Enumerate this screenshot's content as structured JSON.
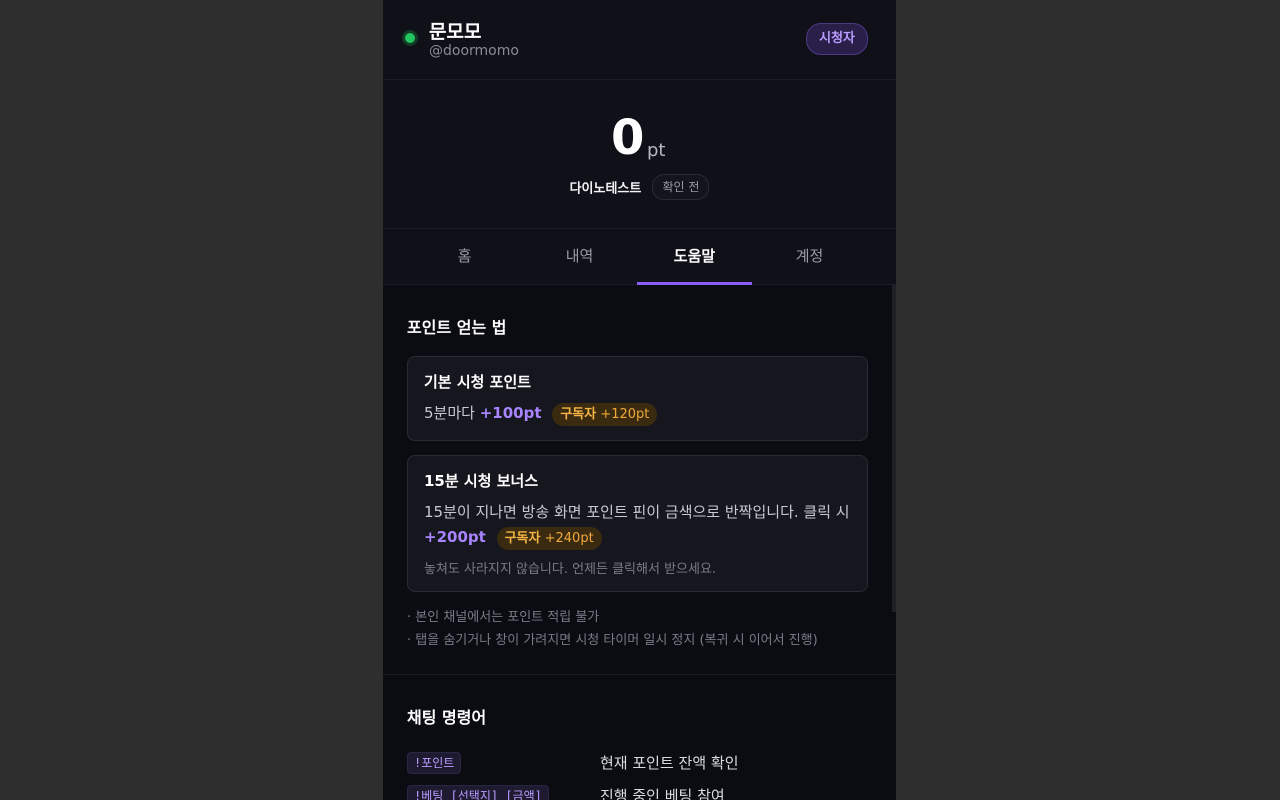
{
  "user": {
    "name": "문모모",
    "handle": "@doormomo",
    "role": "시청자"
  },
  "points": {
    "value": "0",
    "unit": "pt",
    "channel": "다이노테스트",
    "status": "확인 전"
  },
  "tabs": [
    {
      "label": "홈"
    },
    {
      "label": "내역"
    },
    {
      "label": "도움말"
    },
    {
      "label": "계정"
    }
  ],
  "help": {
    "earn_title": "포인트 얻는 법",
    "cards": [
      {
        "title": "기본 시청 포인트",
        "desc": "5분마다",
        "points": "+100pt",
        "sub_label": "구독자",
        "sub_points": "+120pt"
      },
      {
        "title": "15분 시청 보너스",
        "desc": "15분이 지나면 방송 화면 포인트 핀이 금색으로 반짝입니다. 클릭 시",
        "points": "+200pt",
        "sub_label": "구독자",
        "sub_points": "+240pt",
        "note": "놓쳐도 사라지지 않습니다. 언제든 클릭해서 받으세요."
      }
    ],
    "notes": [
      "· 본인 채널에서는 포인트 적립 불가",
      "· 탭을 숨기거나 창이 가려지면 시청 타이머 일시 정지 (복귀 시 이어서 진행)"
    ],
    "commands_title": "채팅 명령어",
    "commands": [
      {
        "code": "!포인트",
        "desc": "현재 포인트 잔액 확인"
      },
      {
        "code": "!베팅 [선택지] [금액]",
        "desc": "진행 중인 베팅 참여"
      }
    ]
  },
  "colors": {
    "accent": "#8b5cf6",
    "subscriber": "#f0a93a",
    "online": "#22c55e"
  }
}
